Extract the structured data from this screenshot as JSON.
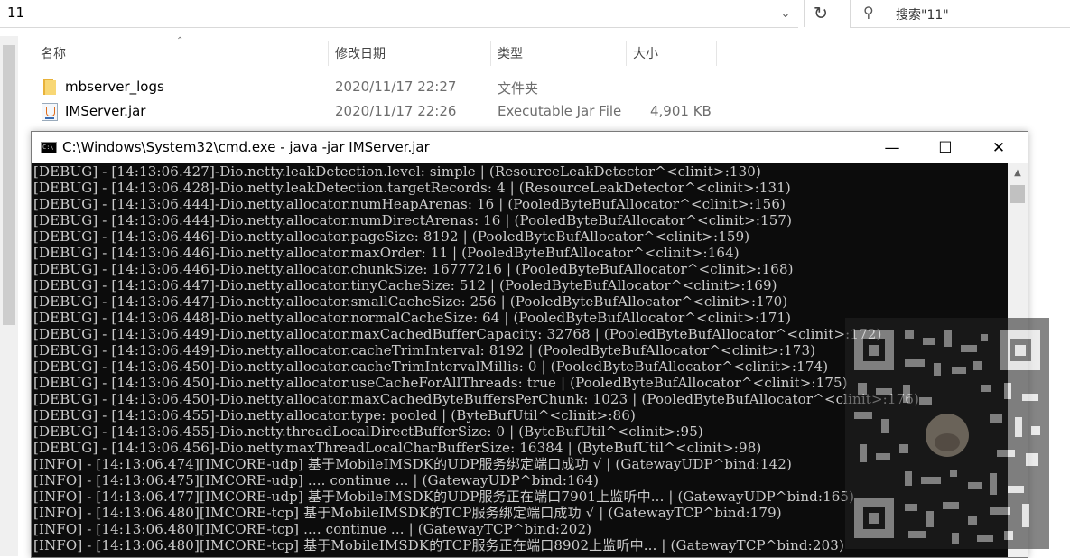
{
  "explorer": {
    "address_value": "11",
    "search_placeholder": "搜索\"11\"",
    "columns": {
      "name": "名称",
      "modified": "修改日期",
      "type": "类型",
      "size": "大小"
    },
    "files": [
      {
        "name": "mbserver_logs",
        "modified": "2020/11/17 22:27",
        "type": "文件夹",
        "size": "",
        "icon": "folder-icon"
      },
      {
        "name": "IMServer.jar",
        "modified": "2020/11/17 22:26",
        "type": "Executable Jar File",
        "size": "4,901 KB",
        "icon": "java-jar-icon"
      }
    ]
  },
  "cmd": {
    "title": "C:\\Windows\\System32\\cmd.exe - java  -jar IMServer.jar",
    "icon_label": "C:\\",
    "minimize": "—",
    "maximize": "☐",
    "close": "✕",
    "lines": [
      "[DEBUG] - [14:13:06.427]-Dio.netty.leakDetection.level: simple | (ResourceLeakDetector^<clinit>:130)",
      "[DEBUG] - [14:13:06.428]-Dio.netty.leakDetection.targetRecords: 4 | (ResourceLeakDetector^<clinit>:131)",
      "[DEBUG] - [14:13:06.444]-Dio.netty.allocator.numHeapArenas: 16 | (PooledByteBufAllocator^<clinit>:156)",
      "[DEBUG] - [14:13:06.444]-Dio.netty.allocator.numDirectArenas: 16 | (PooledByteBufAllocator^<clinit>:157)",
      "[DEBUG] - [14:13:06.446]-Dio.netty.allocator.pageSize: 8192 | (PooledByteBufAllocator^<clinit>:159)",
      "[DEBUG] - [14:13:06.446]-Dio.netty.allocator.maxOrder: 11 | (PooledByteBufAllocator^<clinit>:164)",
      "[DEBUG] - [14:13:06.446]-Dio.netty.allocator.chunkSize: 16777216 | (PooledByteBufAllocator^<clinit>:168)",
      "[DEBUG] - [14:13:06.447]-Dio.netty.allocator.tinyCacheSize: 512 | (PooledByteBufAllocator^<clinit>:169)",
      "[DEBUG] - [14:13:06.447]-Dio.netty.allocator.smallCacheSize: 256 | (PooledByteBufAllocator^<clinit>:170)",
      "[DEBUG] - [14:13:06.448]-Dio.netty.allocator.normalCacheSize: 64 | (PooledByteBufAllocator^<clinit>:171)",
      "[DEBUG] - [14:13:06.449]-Dio.netty.allocator.maxCachedBufferCapacity: 32768 | (PooledByteBufAllocator^<clinit>:172)",
      "[DEBUG] - [14:13:06.449]-Dio.netty.allocator.cacheTrimInterval: 8192 | (PooledByteBufAllocator^<clinit>:173)",
      "[DEBUG] - [14:13:06.450]-Dio.netty.allocator.cacheTrimIntervalMillis: 0 | (PooledByteBufAllocator^<clinit>:174)",
      "[DEBUG] - [14:13:06.450]-Dio.netty.allocator.useCacheForAllThreads: true | (PooledByteBufAllocator^<clinit>:175)",
      "[DEBUG] - [14:13:06.450]-Dio.netty.allocator.maxCachedByteBuffersPerChunk: 1023 | (PooledByteBufAllocator^<clinit>:176)",
      "[DEBUG] - [14:13:06.455]-Dio.netty.allocator.type: pooled | (ByteBufUtil^<clinit>:86)",
      "[DEBUG] - [14:13:06.455]-Dio.netty.threadLocalDirectBufferSize: 0 | (ByteBufUtil^<clinit>:95)",
      "[DEBUG] - [14:13:06.456]-Dio.netty.maxThreadLocalCharBufferSize: 16384 | (ByteBufUtil^<clinit>:98)",
      "[INFO] - [14:13:06.474][IMCORE-udp] 基于MobileIMSDK的UDP服务绑定端口成功 √ | (GatewayUDP^bind:142)",
      "[INFO] - [14:13:06.475][IMCORE-udp] .... continue ... | (GatewayUDP^bind:164)",
      "[INFO] - [14:13:06.477][IMCORE-udp] 基于MobileIMSDK的UDP服务正在端口7901上监听中... | (GatewayUDP^bind:165)",
      "[INFO] - [14:13:06.480][IMCORE-tcp] 基于MobileIMSDK的TCP服务绑定端口成功 √ | (GatewayTCP^bind:179)",
      "[INFO] - [14:13:06.480][IMCORE-tcp] .... continue ... | (GatewayTCP^bind:202)",
      "[INFO] - [14:13:06.480][IMCORE-tcp] 基于MobileIMSDK的TCP服务正在端口8902上监听中... | (GatewayTCP^bind:203)"
    ]
  }
}
